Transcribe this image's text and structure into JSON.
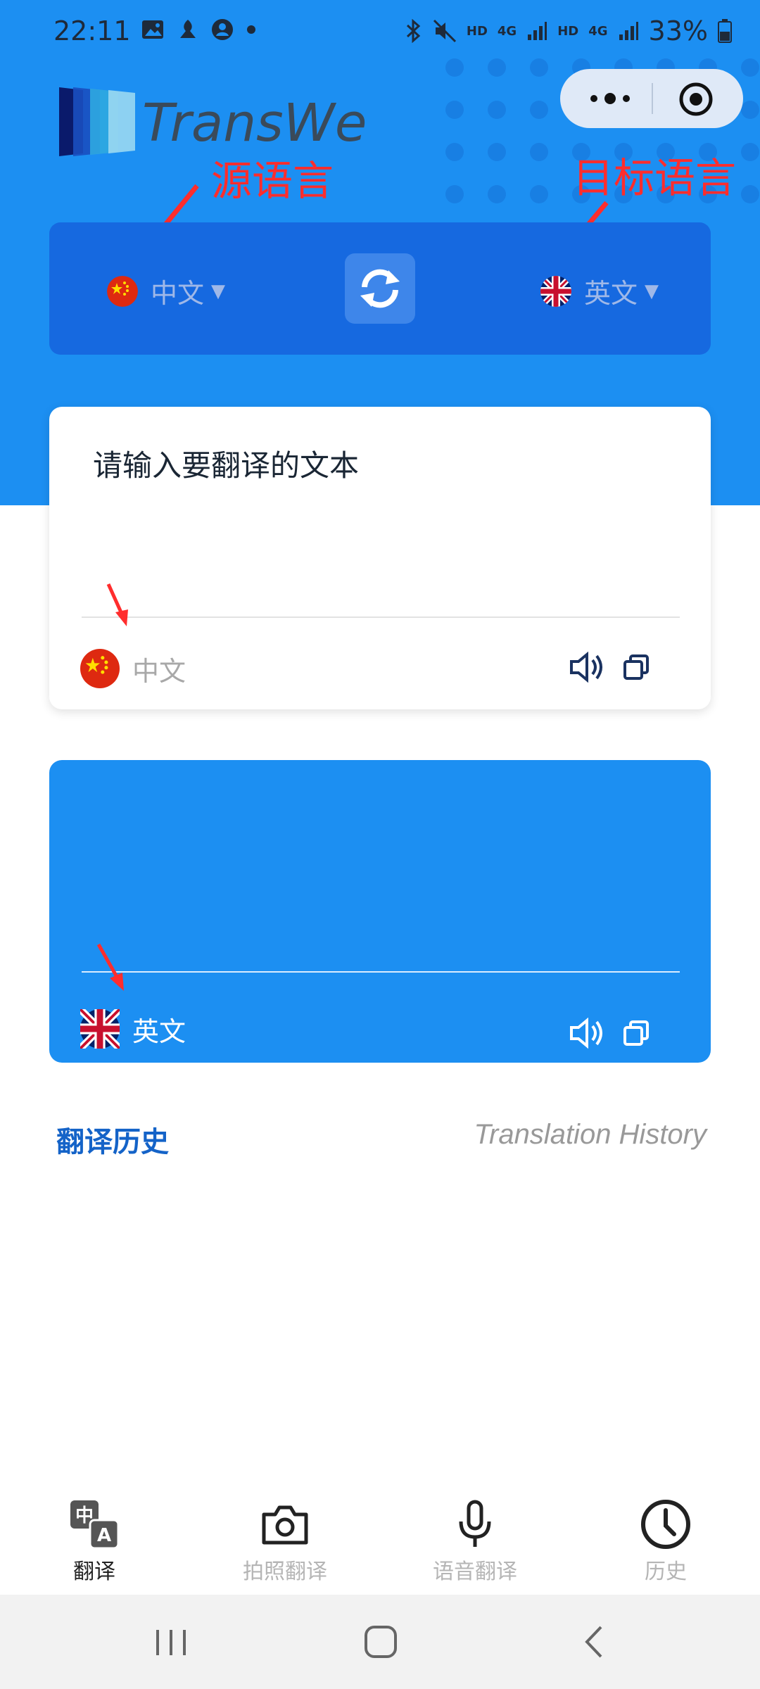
{
  "status": {
    "time": "22:11",
    "net1": "HD",
    "net2": "4G",
    "net3": "HD",
    "net4": "4G",
    "battery": "33%"
  },
  "app": {
    "name": "TransWe"
  },
  "annotations": {
    "source_lang": "源语言",
    "target_lang": "目标语言"
  },
  "lang_bar": {
    "source": {
      "label": "中文",
      "flag": "china-flag"
    },
    "target": {
      "label": "英文",
      "flag": "uk-flag"
    }
  },
  "input_card": {
    "placeholder": "请输入要翻译的文本",
    "lang_label": "中文"
  },
  "output_card": {
    "lang_label": "英文"
  },
  "history": {
    "title_cn": "翻译历史",
    "title_en": "Translation History"
  },
  "tabs": [
    {
      "label": "翻译",
      "icon": "translate-icon",
      "active": true
    },
    {
      "label": "拍照翻译",
      "icon": "camera-icon",
      "active": false
    },
    {
      "label": "语音翻译",
      "icon": "microphone-icon",
      "active": false
    },
    {
      "label": "历史",
      "icon": "clock-icon",
      "active": false
    }
  ],
  "colors": {
    "primary": "#1c8ff2",
    "lang_bar": "#1669e0",
    "annotation": "#ff2d2d",
    "history_title": "#1463c8"
  }
}
